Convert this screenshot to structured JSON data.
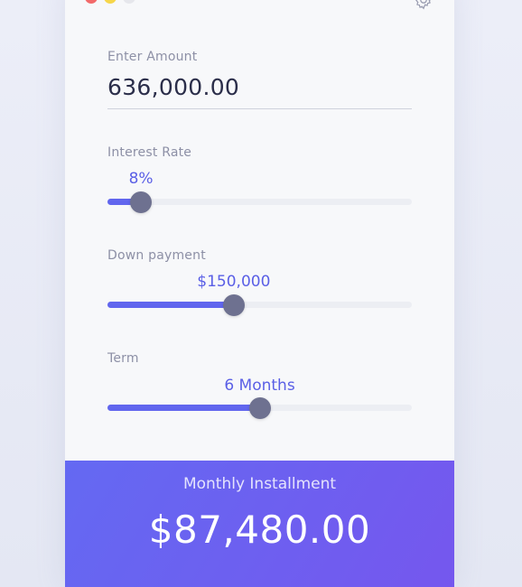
{
  "window": {
    "controls": [
      "close",
      "minimize",
      "maximize"
    ],
    "settings_icon": "gear-icon"
  },
  "amount": {
    "label": "Enter Amount",
    "value": "636,000.00"
  },
  "interest_rate": {
    "label": "Interest Rate",
    "value_text": "8%",
    "fraction": 0.11
  },
  "down_payment": {
    "label": "Down payment",
    "value_text": "$150,000",
    "fraction": 0.415
  },
  "term": {
    "label": "Term",
    "value_text": "6 Months",
    "fraction": 0.5
  },
  "result": {
    "label": "Monthly Installment",
    "amount": "$87,480.00"
  },
  "colors": {
    "accent": "#6166ee",
    "thumb": "#6e7190",
    "track": "#eceef3",
    "gradient_start": "#6469f2",
    "gradient_end": "#7557ee"
  }
}
